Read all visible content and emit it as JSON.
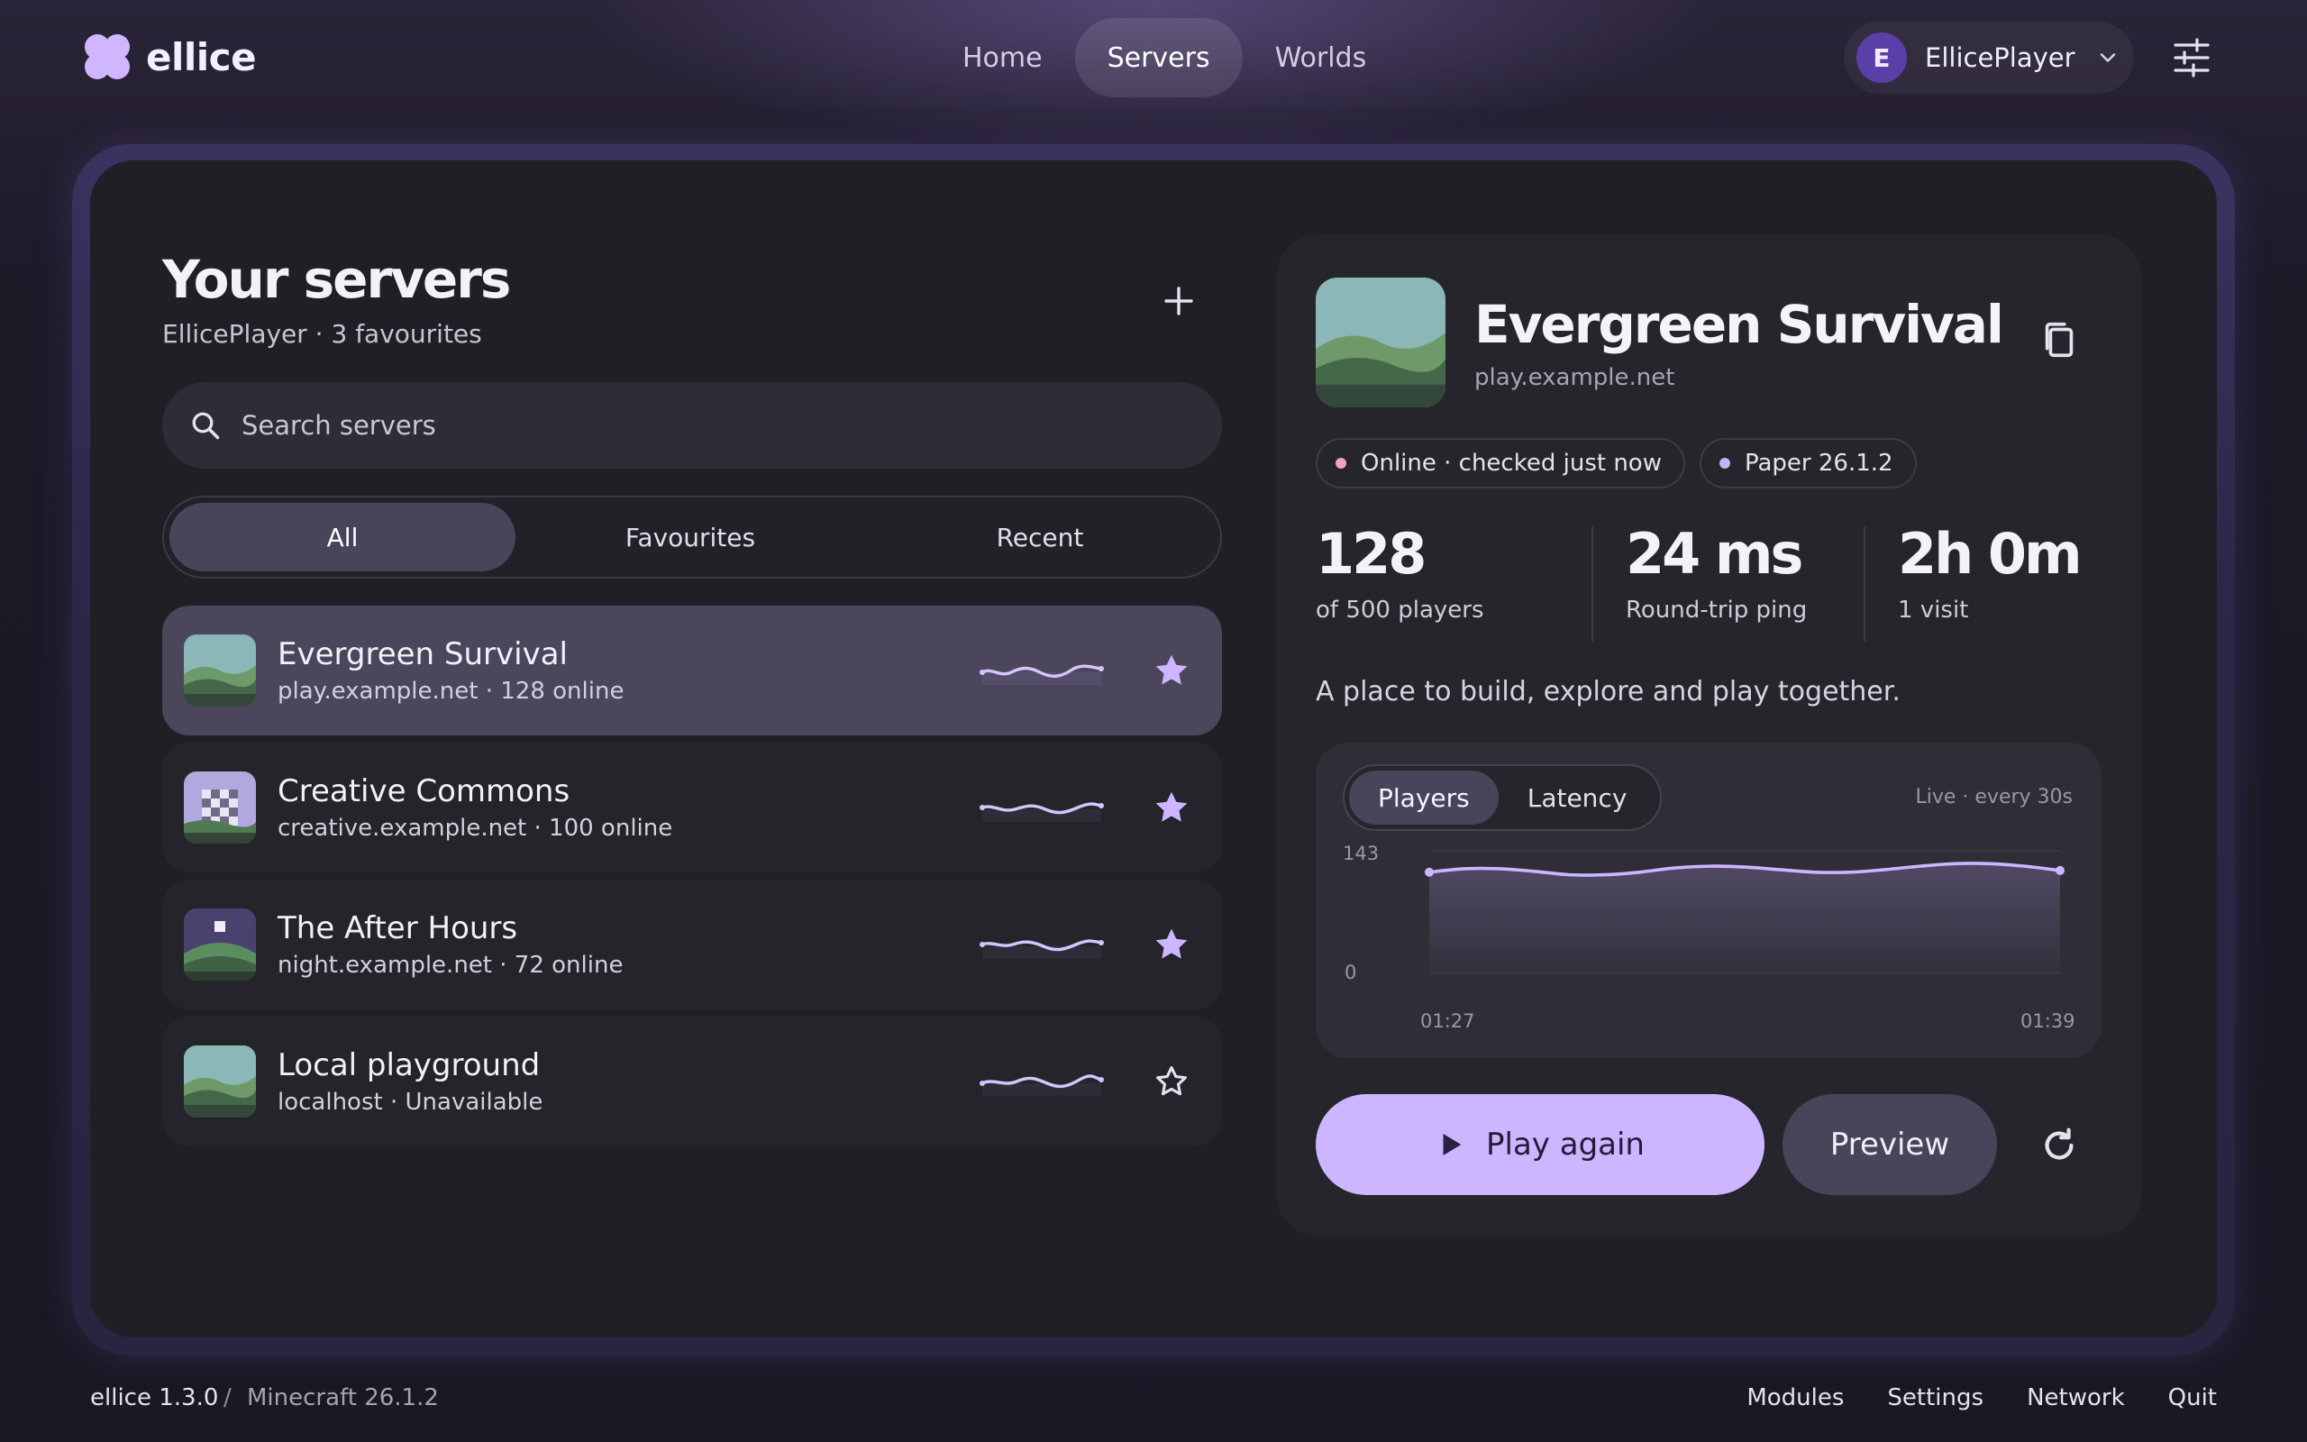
{
  "app": {
    "name": "ellice"
  },
  "nav": {
    "items": [
      "Home",
      "Servers",
      "Worlds"
    ],
    "active": "Servers"
  },
  "user": {
    "initial": "E",
    "name": "EllicePlayer"
  },
  "servers_panel": {
    "title": "Your servers",
    "subtitle": "EllicePlayer · 3 favourites",
    "search_placeholder": "Search servers",
    "filters": [
      "All",
      "Favourites",
      "Recent"
    ],
    "active_filter": "All",
    "servers": [
      {
        "name": "Evergreen Survival",
        "sub": "play.example.net · 128 online",
        "favourite": true,
        "selected": true,
        "thumb": "hills"
      },
      {
        "name": "Creative Commons",
        "sub": "creative.example.net · 100 online",
        "favourite": true,
        "selected": false,
        "thumb": "checker"
      },
      {
        "name": "The After Hours",
        "sub": "night.example.net · 72 online",
        "favourite": true,
        "selected": false,
        "thumb": "night"
      },
      {
        "name": "Local playground",
        "sub": "localhost · Unavailable",
        "favourite": false,
        "selected": false,
        "thumb": "hills"
      }
    ]
  },
  "detail": {
    "name": "Evergreen Survival",
    "host": "play.example.net",
    "status_chip": "Online · checked just now",
    "version_chip": "Paper 26.1.2",
    "stats": [
      {
        "value": "128",
        "label": "of 500 players"
      },
      {
        "value": "24 ms",
        "label": "Round-trip ping"
      },
      {
        "value": "2h 0m",
        "label": "1 visit"
      }
    ],
    "description": "A place to build, explore and play together.",
    "chart_tabs": [
      "Players",
      "Latency"
    ],
    "active_chart_tab": "Players",
    "live_label": "Live · every 30s",
    "play_label": "Play again",
    "preview_label": "Preview"
  },
  "chart_data": {
    "type": "area",
    "series": [
      {
        "values": [
          118,
          122,
          122,
          119,
          115,
          115,
          118,
          123,
          125,
          124,
          121,
          118,
          118,
          121,
          125,
          128,
          128,
          125,
          120
        ]
      }
    ],
    "ylim": [
      0,
      143
    ],
    "ytick_labels": [
      "143",
      "0"
    ],
    "xtick_labels": [
      "01:27",
      "01:39"
    ],
    "grid": true
  },
  "footer": {
    "version": "ellice 1.3.0",
    "separator": "/",
    "minecraft": "Minecraft 26.1.2",
    "links": [
      "Modules",
      "Settings",
      "Network",
      "Quit"
    ]
  },
  "colors": {
    "accent": "#cdb6ff",
    "online_dot": "#f0a4bf",
    "version_dot": "#c4b2f2",
    "background": "#1d1a28"
  }
}
